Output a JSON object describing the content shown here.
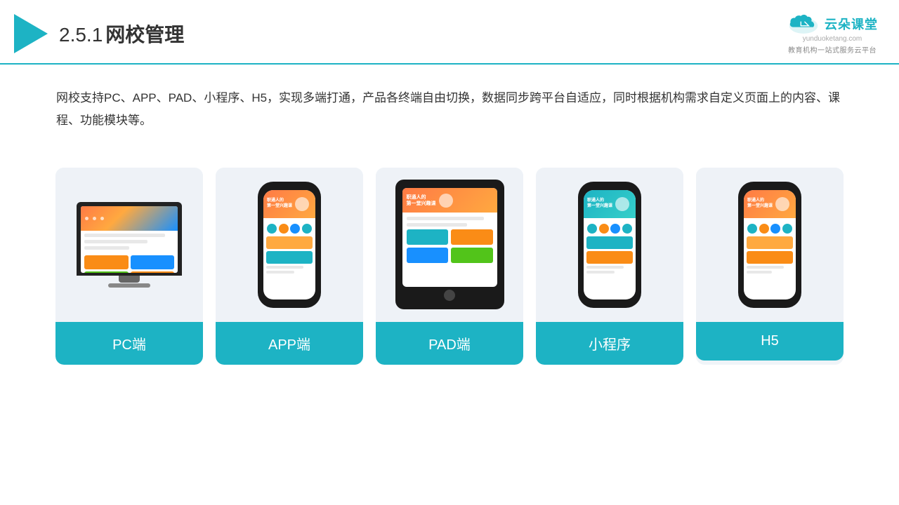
{
  "header": {
    "section_number": "2.5.1",
    "title": "网校管理",
    "brand_name": "云朵课堂",
    "brand_url": "yunduoketang.com",
    "brand_slogan": "教育机构一站\n式服务云平台"
  },
  "description": {
    "text": "网校支持PC、APP、PAD、小程序、H5，实现多端打通，产品各终端自由切换，数据同步跨平台自适应，同时根据机构需求自定义页面上的内容、课程、功能模块等。"
  },
  "cards": [
    {
      "id": "pc",
      "label": "PC端",
      "device_type": "pc"
    },
    {
      "id": "app",
      "label": "APP端",
      "device_type": "phone"
    },
    {
      "id": "pad",
      "label": "PAD端",
      "device_type": "pad"
    },
    {
      "id": "miniapp",
      "label": "小程序",
      "device_type": "phone"
    },
    {
      "id": "h5",
      "label": "H5",
      "device_type": "phone"
    }
  ]
}
